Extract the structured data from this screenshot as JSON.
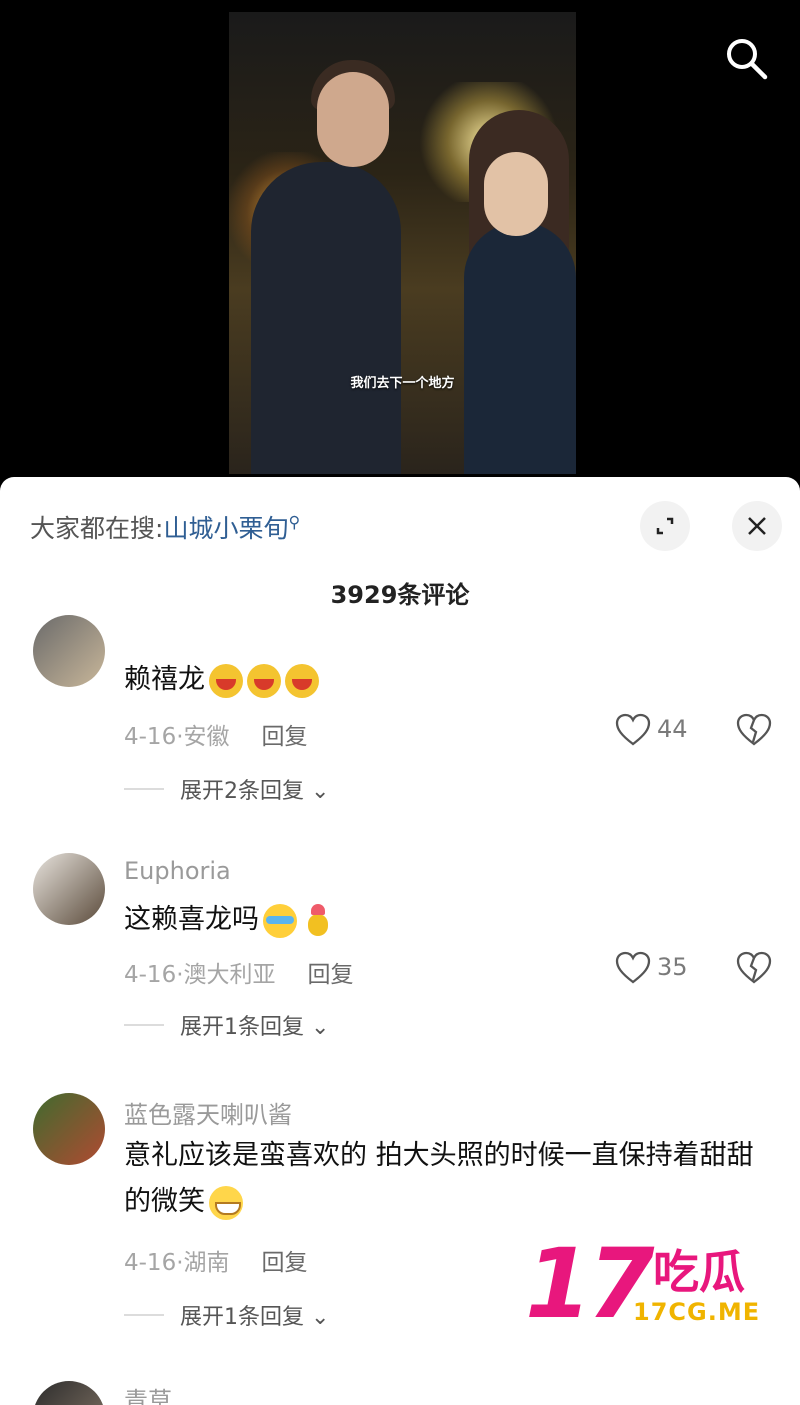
{
  "video": {
    "subtitle": "我们去下一个地方"
  },
  "header": {
    "search_prefix": "大家都在搜:",
    "search_term": "山城小栗旬",
    "search_icon": "search-icon",
    "comment_count": "3929条评论"
  },
  "comments": [
    {
      "username": "",
      "text": "赖禧龙",
      "emojis": [
        "laugh-emoji",
        "laugh-emoji",
        "laugh-emoji"
      ],
      "date": "4-16",
      "location": "安徽",
      "reply": "回复",
      "likes": "44",
      "expand": "展开2条回复"
    },
    {
      "username": "Euphoria",
      "text": "这赖喜龙吗",
      "emojis": [
        "crying-laugh-emoji",
        "gift-emoji"
      ],
      "date": "4-16",
      "location": "澳大利亚",
      "reply": "回复",
      "likes": "35",
      "expand": "展开1条回复"
    },
    {
      "username": "蓝色露天喇叭酱",
      "text": "意礼应该是蛮喜欢的 拍大头照的时候一直保持着甜甜的微笑",
      "emojis": [
        "grin-emoji"
      ],
      "date": "4-16",
      "location": "湖南",
      "reply": "回复",
      "likes": "",
      "expand": "展开1条回复"
    },
    {
      "username": "青草",
      "text": "",
      "date": "",
      "location": "",
      "reply": "",
      "likes": "",
      "expand": ""
    }
  ],
  "watermark": {
    "number": "17",
    "chinese": "吃瓜",
    "domain": "17CG.ME"
  },
  "colors": {
    "link_blue": "#2f5e93",
    "watermark_pink": "#e8177d",
    "watermark_gold": "#f0b400"
  }
}
